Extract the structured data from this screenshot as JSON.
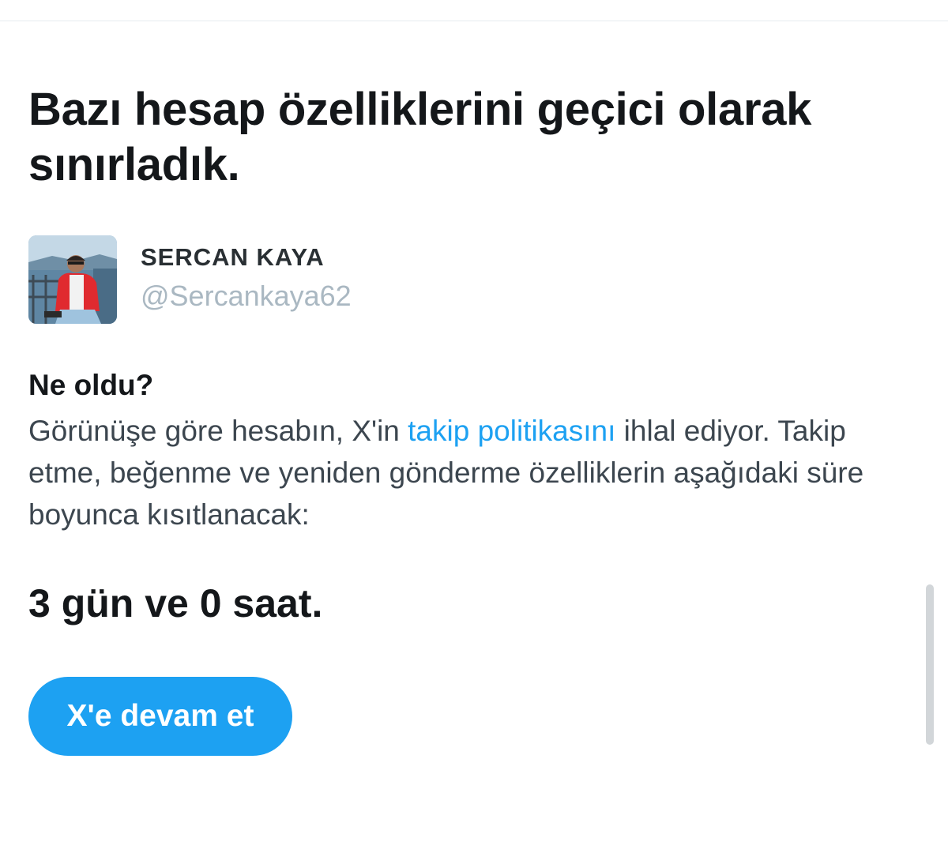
{
  "page": {
    "title": "Bazı hesap özelliklerini geçici olarak sınırladık."
  },
  "user": {
    "display_name": "SERCAN KAYA",
    "screen_name": "@Sercankaya62"
  },
  "notice": {
    "heading": "Ne oldu?",
    "text_before_link": "Görünüşe göre hesabın, X'in ",
    "link_text": "takip politikasını",
    "text_after_link": " ihlal ediyor. Takip etme, beğenme ve yeniden gönderme özelliklerin aşağıdaki süre boyunca kısıtlanacak:",
    "duration": "3 gün ve 0 saat."
  },
  "actions": {
    "continue_label": "X'e devam et"
  },
  "colors": {
    "accent": "#1da1f2",
    "text_primary": "#14171a",
    "text_secondary": "#aab8c2",
    "scrollbar": "#d2d6d9"
  }
}
